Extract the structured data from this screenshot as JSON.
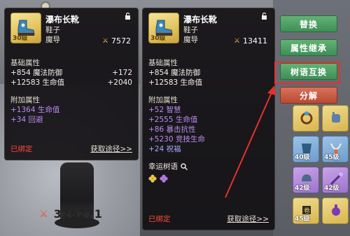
{
  "left_item": {
    "name": "瀑布长靴",
    "type": "鞋子",
    "school": "魔导",
    "level": "30级",
    "score": "7572",
    "base_title": "基础属性",
    "base_stats": [
      {
        "left": "+854 魔法防御",
        "right": "+172"
      },
      {
        "left": "+12583 生命值",
        "right": "+2040"
      }
    ],
    "extra_title": "附加属性",
    "extra_stats": [
      "+1364 生命值",
      "+34 回避"
    ],
    "bound": "已绑定",
    "source": "获取途径>>"
  },
  "right_item": {
    "name": "瀑布长靴",
    "type": "鞋子",
    "school": "魔导",
    "level": "30级",
    "score": "13411",
    "base_title": "基础属性",
    "base_stats": [
      {
        "left": "+854 魔法防御"
      },
      {
        "left": "+12583 生命值"
      }
    ],
    "extra_title": "附加属性",
    "extra_stats": [
      "+52 智慧",
      "+2555 生命值",
      "+86 暴击抗性",
      "+5230 竞技生命",
      "+24 祝福"
    ],
    "luck_title": "幸运树语",
    "bound": "已绑定",
    "source": "获取途径>>"
  },
  "actions": {
    "replace": "替换",
    "inherit": "属性继承",
    "swap": "树语互换",
    "decompose": "分解"
  },
  "player": {
    "power": "326271"
  },
  "inventory": [
    {
      "level": "40级"
    },
    {
      "level": "45级"
    },
    {
      "level": "42级"
    },
    {
      "level": "45级"
    },
    {
      "level": "42级"
    }
  ],
  "colors": {
    "accent_green": "#4f9f64",
    "accent_red": "#c85a42",
    "highlight": "#e8302a",
    "bound_red": "#ff4a3a",
    "extra_purple": "#b98cf0"
  }
}
